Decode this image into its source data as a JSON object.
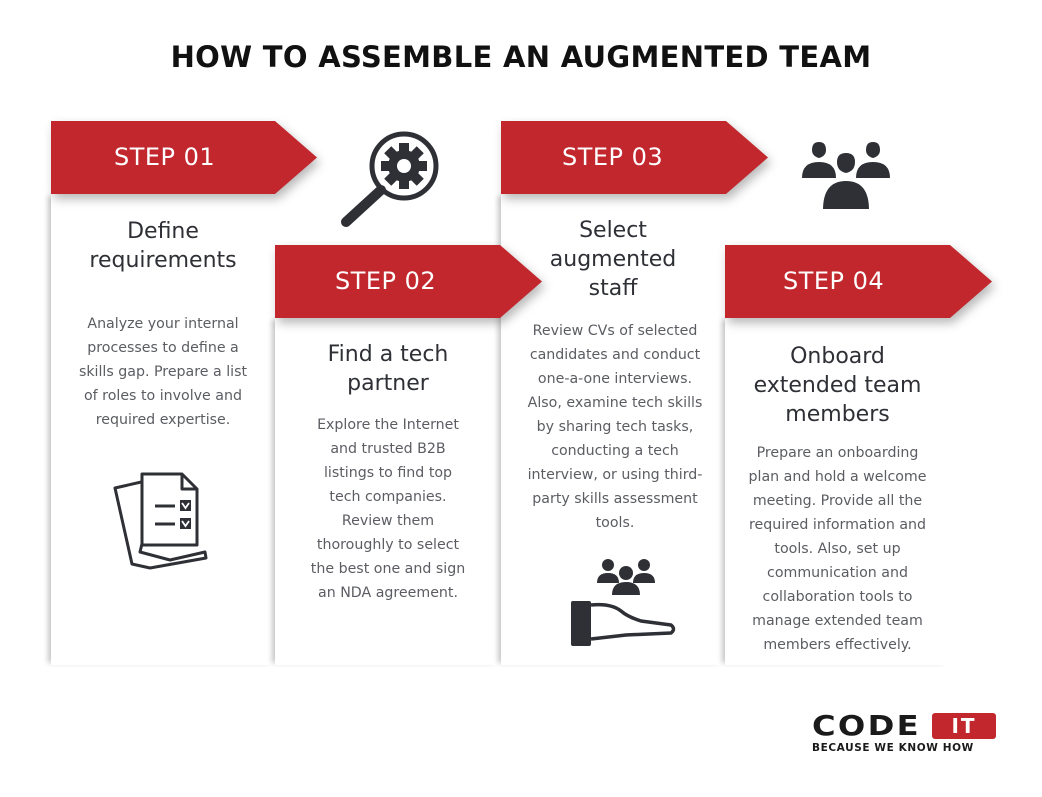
{
  "title": "HOW TO ASSEMBLE AN AUGMENTED TEAM",
  "accent_color": "#c1272d",
  "steps": [
    {
      "label": "STEP 01",
      "heading": [
        "Define",
        "requirements"
      ],
      "description": [
        "Analyze your internal",
        "processes to define a",
        "skills gap. Prepare a list",
        "of roles to involve and",
        "required expertise."
      ],
      "icon": "checklist-documents-icon",
      "side_icon": "magnifier-gear-icon"
    },
    {
      "label": "STEP 02",
      "heading": [
        "Find a tech",
        "partner"
      ],
      "description": [
        "Explore the Internet",
        "and trusted B2B",
        "listings to find top",
        "tech companies.",
        "Review them",
        "thoroughly to select",
        "the best one and sign",
        "an NDA agreement."
      ]
    },
    {
      "label": "STEP 03",
      "heading": [
        "Select",
        "augmented",
        "staff"
      ],
      "description": [
        "Review CVs of selected",
        "candidates and conduct",
        "one-a-one interviews.",
        "Also, examine tech skills",
        "by sharing tech tasks,",
        "conducting a tech",
        "interview, or using third-",
        "party skills assessment",
        "tools."
      ],
      "icon": "hand-holding-team-icon",
      "side_icon": "team-group-icon"
    },
    {
      "label": "STEP 04",
      "heading": [
        "Onboard",
        "extended team",
        "members"
      ],
      "description": [
        "Prepare an onboarding",
        "plan and hold a welcome",
        "meeting. Provide all the",
        "required information and",
        "tools. Also, set up",
        "communication and",
        "collaboration tools to",
        "manage extended team",
        "members effectively."
      ]
    }
  ],
  "logo": {
    "name_left": "CODE",
    "name_right": "IT",
    "tagline": "BECAUSE WE KNOW HOW"
  }
}
